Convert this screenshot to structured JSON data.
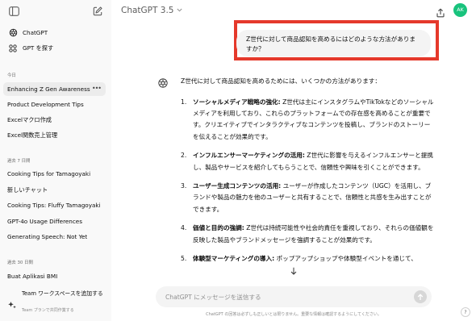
{
  "sidebar": {
    "nav": [
      {
        "label": "ChatGPT",
        "icon": "openai-logo-icon"
      },
      {
        "label": "GPT を探す",
        "icon": "grid-icon"
      }
    ],
    "sections": [
      {
        "title": "今日",
        "items": [
          "Enhancing Z Gen Awareness",
          "Product Development Tips",
          "Excelマクロ作成",
          "Excel関数売上管理"
        ]
      },
      {
        "title": "過去 7 日間",
        "items": [
          "Cooking Tips for Tamagoyaki",
          "新しいチャット",
          "Cooking Tips: Fluffy Tamagoyaki",
          "GPT-4o Usage Differences",
          "Generating Speech: Not Yet"
        ]
      },
      {
        "title": "過去 30 日間",
        "items": [
          "Buat Aplikasi BMI"
        ]
      }
    ],
    "active_item": "Enhancing Z Gen Awareness",
    "team": {
      "title": "Team ワークスペースを追加する",
      "subtitle": "Team プランで共同作業する"
    }
  },
  "header": {
    "model": "ChatGPT 3.5",
    "avatar": "AK"
  },
  "conversation": {
    "user_message": "Z世代に対して商品認知を高めるにはどのような方法がありますか？",
    "intro": "Z世代に対して商品認知を高めるためには、いくつかの方法があります：",
    "items": [
      {
        "num": "1.",
        "title": "ソーシャルメディア戦略の強化:",
        "text": " Z世代は主にインスタグラムやTikTokなどのソーシャルメディアを利用しており、これらのプラットフォームでの存在感を高めることが重要です。クリエイティブでインタラクティブなコンテンツを投稿し、ブランドのストーリーを伝えることが効果的です。"
      },
      {
        "num": "2.",
        "title": "インフルエンサーマーケティングの活用:",
        "text": " Z世代に影響を与えるインフルエンサーと提携し、製品やサービスを紹介してもらうことで、信頼性や興味を引くことができます。"
      },
      {
        "num": "3.",
        "title": "ユーザー生成コンテンツの活用:",
        "text": " ユーザーが作成したコンテンツ（UGC）を活用し、ブランドや製品の魅力を他のユーザーと共有することで、信頼性と共感を生み出すことができます。"
      },
      {
        "num": "4.",
        "title": "価値と目的の強調:",
        "text": " Z世代は持続可能性や社会的責任を重視しており、それらの価値観を反映した製品やブランドメッセージを強調することが効果的です。"
      },
      {
        "num": "5.",
        "title": "体験型マーケティングの導入:",
        "text": " ポップアップショップや体験型イベントを通じて、"
      }
    ]
  },
  "composer": {
    "placeholder": "ChatGPT にメッセージを送信する"
  },
  "disclaimer": "ChatGPT の回答は必ずしも正しいとは限りません。重要な情報は確認するようにしてください。",
  "help": "?",
  "colors": {
    "highlight_frame": "#e5392b",
    "avatar_bg": "#19c37d",
    "sidebar_bg": "#f9f9f9"
  }
}
